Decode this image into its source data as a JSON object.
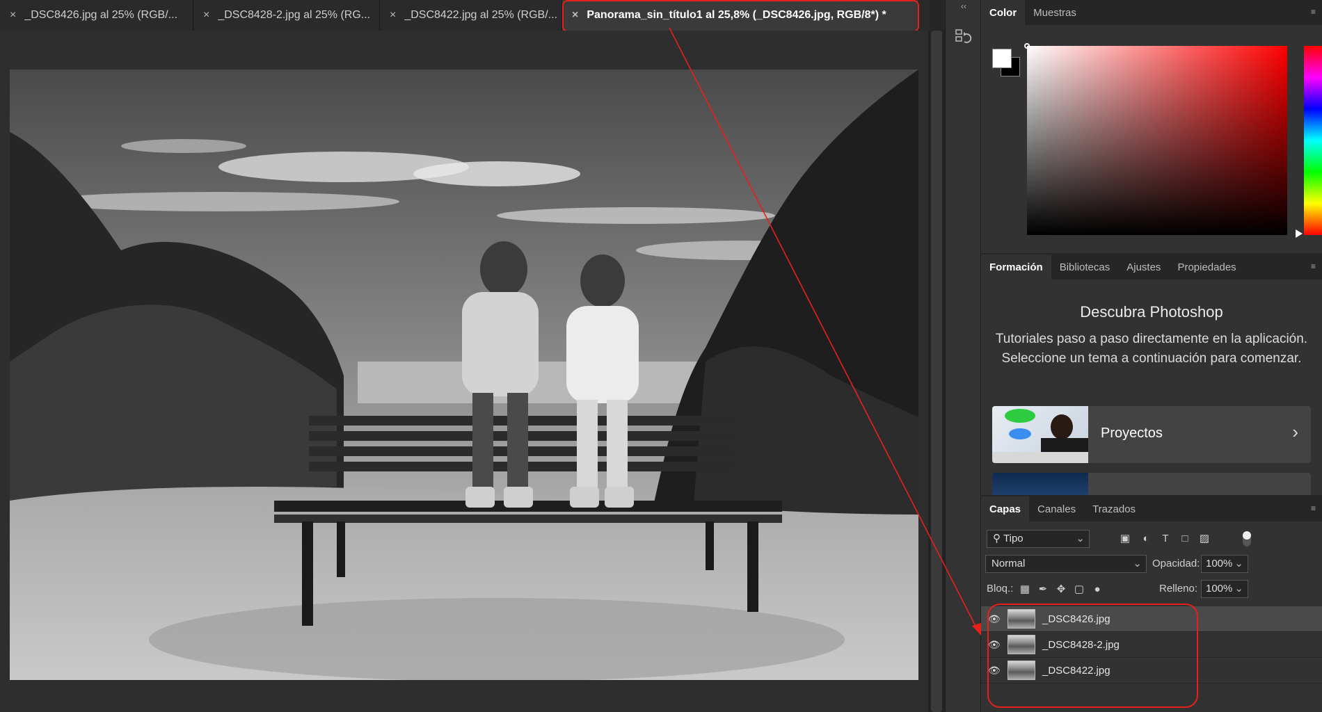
{
  "tabs": [
    {
      "label": "_DSC8426.jpg al 25% (RGB/...",
      "active": false
    },
    {
      "label": "_DSC8428-2.jpg al 25% (RG...",
      "active": false
    },
    {
      "label": "_DSC8422.jpg al 25% (RGB/...",
      "active": false
    },
    {
      "label": "Panorama_sin_título1 al 25,8% (_DSC8426.jpg, RGB/8*) *",
      "active": true
    }
  ],
  "close_glyph": "×",
  "color_panel": {
    "tabs": [
      "Color",
      "Muestras"
    ],
    "foreground": "#ffffff",
    "background": "#000000"
  },
  "learn_panel": {
    "tabs": [
      "Formación",
      "Bibliotecas",
      "Ajustes",
      "Propiedades"
    ],
    "title": "Descubra Photoshop",
    "description": "Tutoriales paso a paso directamente en la aplicación. Seleccione un tema a continuación para comenzar.",
    "card_label": "Proyectos"
  },
  "layers_panel": {
    "tabs": [
      "Capas",
      "Canales",
      "Trazados"
    ],
    "filter_label": "Tipo",
    "blend_mode": "Normal",
    "opacity_label": "Opacidad:",
    "opacity": "100%",
    "lock_label": "Bloq.:",
    "fill_label": "Relleno:",
    "fill": "100%",
    "layers": [
      {
        "name": "_DSC8426.jpg",
        "selected": true
      },
      {
        "name": "_DSC8428-2.jpg",
        "selected": false
      },
      {
        "name": "_DSC8422.jpg",
        "selected": false
      }
    ]
  },
  "icons": {
    "filter_icons": [
      "image-filter-icon",
      "adjustment-filter-icon",
      "type-filter-icon",
      "shape-filter-icon",
      "smart-object-filter-icon"
    ],
    "lock_icons": [
      "lock-pixels-icon",
      "lock-paint-icon",
      "lock-position-icon",
      "lock-artboard-icon",
      "lock-all-icon"
    ]
  },
  "accent_color": "#e8201a"
}
